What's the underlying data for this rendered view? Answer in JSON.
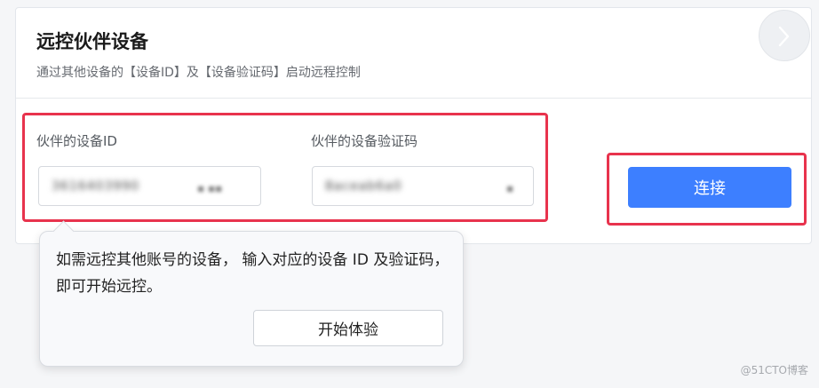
{
  "card": {
    "title": "远控伙伴设备",
    "subtitle": "通过其他设备的【设备ID】及【设备验证码】启动远程控制"
  },
  "fields": {
    "device_id_label": "伙伴的设备ID",
    "device_id_value": "3616403990",
    "device_id_extra": "▪ ▪▪",
    "code_label": "伙伴的设备验证码",
    "code_value": "8aceab6a0",
    "code_extra": "▪"
  },
  "connect_label": "连接",
  "tooltip": {
    "text": "如需远控其他账号的设备， 输入对应的设备 ID 及验证码，即可开始远控。",
    "button_label": "开始体验"
  },
  "watermark": "@51CTO博客",
  "colors": {
    "accent": "#3d7fff",
    "highlight": "#e8334d"
  }
}
